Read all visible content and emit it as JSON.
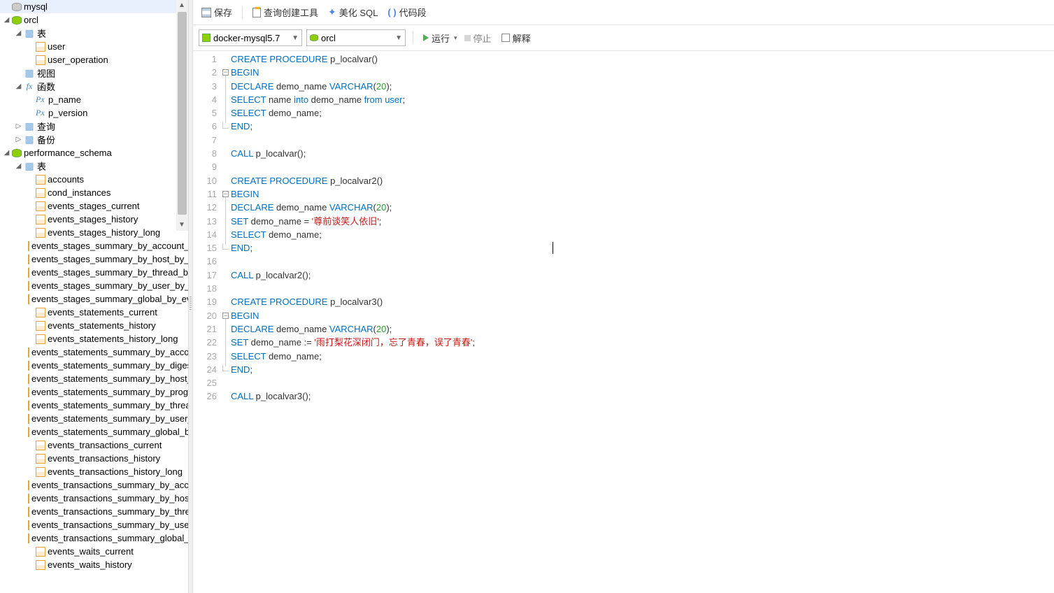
{
  "toolbar": {
    "save": "保存",
    "queryBuilder": "查询创建工具",
    "beautify": "美化 SQL",
    "segment": "代码段"
  },
  "subtoolbar": {
    "connection": "docker-mysql5.7",
    "database": "orcl",
    "run": "运行",
    "stop": "停止",
    "explain": "解释"
  },
  "tree": {
    "mysql": "mysql",
    "orcl": "orcl",
    "tablesFolder": "表",
    "tables_orcl": [
      "user",
      "user_operation"
    ],
    "viewsFolder": "视图",
    "funcFolder": "函数",
    "funcs": [
      "p_name",
      "p_version"
    ],
    "queryFolder": "查询",
    "backupFolder": "备份",
    "perfSchema": "performance_schema",
    "perfTables": [
      "accounts",
      "cond_instances",
      "events_stages_current",
      "events_stages_history",
      "events_stages_history_long",
      "events_stages_summary_by_account_by_event_name",
      "events_stages_summary_by_host_by_event_name",
      "events_stages_summary_by_thread_by_event_name",
      "events_stages_summary_by_user_by_event_name",
      "events_stages_summary_global_by_event_name",
      "events_statements_current",
      "events_statements_history",
      "events_statements_history_long",
      "events_statements_summary_by_account_by_event_name",
      "events_statements_summary_by_digest",
      "events_statements_summary_by_host_by_event_name",
      "events_statements_summary_by_program",
      "events_statements_summary_by_thread_by_event_name",
      "events_statements_summary_by_user_by_event_name",
      "events_statements_summary_global_by_event_name",
      "events_transactions_current",
      "events_transactions_history",
      "events_transactions_history_long",
      "events_transactions_summary_by_account_by_event_name",
      "events_transactions_summary_by_host_by_event_name",
      "events_transactions_summary_by_thread_by_event_name",
      "events_transactions_summary_by_user_by_event_name",
      "events_transactions_summary_global_by_event_name",
      "events_waits_current",
      "events_waits_history"
    ]
  },
  "code": {
    "lines": [
      [
        {
          "t": "CREATE",
          "c": "kw"
        },
        {
          "t": " "
        },
        {
          "t": "PROCEDURE",
          "c": "kw"
        },
        {
          "t": " p_localvar()"
        }
      ],
      [
        {
          "t": "BEGIN",
          "c": "kw"
        }
      ],
      [
        {
          "t": "DECLARE",
          "c": "kw"
        },
        {
          "t": " demo_name "
        },
        {
          "t": "VARCHAR",
          "c": "ty"
        },
        {
          "t": "("
        },
        {
          "t": "20",
          "c": "num"
        },
        {
          "t": ");"
        }
      ],
      [
        {
          "t": "SELECT",
          "c": "kw"
        },
        {
          "t": " name "
        },
        {
          "t": "into",
          "c": "kw"
        },
        {
          "t": " demo_name "
        },
        {
          "t": "from",
          "c": "kw"
        },
        {
          "t": " "
        },
        {
          "t": "user",
          "c": "kw"
        },
        {
          "t": ";"
        }
      ],
      [
        {
          "t": "SELECT",
          "c": "kw"
        },
        {
          "t": " demo_name;"
        }
      ],
      [
        {
          "t": "END",
          "c": "kw"
        },
        {
          "t": ";"
        }
      ],
      [],
      [
        {
          "t": "CALL",
          "c": "kw"
        },
        {
          "t": " p_localvar();"
        }
      ],
      [],
      [
        {
          "t": "CREATE",
          "c": "kw"
        },
        {
          "t": " "
        },
        {
          "t": "PROCEDURE",
          "c": "kw"
        },
        {
          "t": " p_localvar2()"
        }
      ],
      [
        {
          "t": "BEGIN",
          "c": "kw"
        }
      ],
      [
        {
          "t": "DECLARE",
          "c": "kw"
        },
        {
          "t": " demo_name "
        },
        {
          "t": "VARCHAR",
          "c": "ty"
        },
        {
          "t": "("
        },
        {
          "t": "20",
          "c": "num"
        },
        {
          "t": ");"
        }
      ],
      [
        {
          "t": "SET",
          "c": "kw"
        },
        {
          "t": " demo_name = "
        },
        {
          "t": "'尊前谈笑人依旧'",
          "c": "str"
        },
        {
          "t": ";"
        }
      ],
      [
        {
          "t": "SELECT",
          "c": "kw"
        },
        {
          "t": " demo_name;"
        }
      ],
      [
        {
          "t": "END",
          "c": "kw"
        },
        {
          "t": ";"
        }
      ],
      [],
      [
        {
          "t": "CALL",
          "c": "kw"
        },
        {
          "t": " p_localvar2();"
        }
      ],
      [],
      [
        {
          "t": "CREATE",
          "c": "kw"
        },
        {
          "t": " "
        },
        {
          "t": "PROCEDURE",
          "c": "kw"
        },
        {
          "t": " p_localvar3()"
        }
      ],
      [
        {
          "t": "BEGIN",
          "c": "kw"
        }
      ],
      [
        {
          "t": "DECLARE",
          "c": "kw"
        },
        {
          "t": " demo_name "
        },
        {
          "t": "VARCHAR",
          "c": "ty"
        },
        {
          "t": "("
        },
        {
          "t": "20",
          "c": "num"
        },
        {
          "t": ");"
        }
      ],
      [
        {
          "t": "SET",
          "c": "kw"
        },
        {
          "t": " demo_name := "
        },
        {
          "t": "'雨打梨花深闭门，忘了青春，误了青春'",
          "c": "str"
        },
        {
          "t": ";"
        }
      ],
      [
        {
          "t": "SELECT",
          "c": "kw"
        },
        {
          "t": " demo_name;"
        }
      ],
      [
        {
          "t": "END",
          "c": "kw"
        },
        {
          "t": ";"
        }
      ],
      [],
      [
        {
          "t": "CALL",
          "c": "kw"
        },
        {
          "t": " p_localvar3();"
        }
      ]
    ],
    "folds": [
      {
        "line": 2,
        "endLine": 6
      },
      {
        "line": 11,
        "endLine": 15
      },
      {
        "line": 20,
        "endLine": 24
      }
    ],
    "cursorLine": 15,
    "cursorCol": 460
  }
}
